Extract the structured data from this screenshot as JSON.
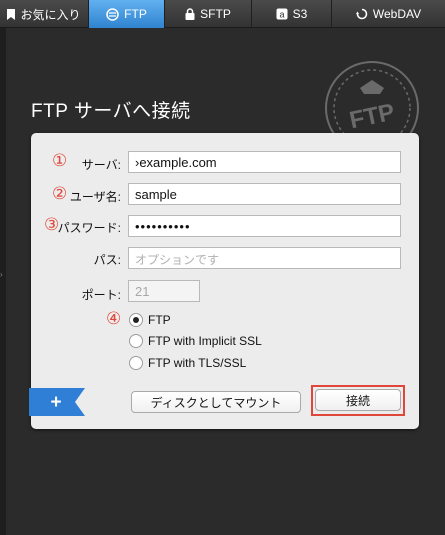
{
  "tabs": [
    {
      "label": "お気に入り",
      "icon": "bookmark-icon",
      "active": false
    },
    {
      "label": "FTP",
      "icon": "ftp-globe-icon",
      "active": true
    },
    {
      "label": "SFTP",
      "icon": "lock-icon",
      "active": false
    },
    {
      "label": "S3",
      "icon": "s3-logo-icon",
      "active": false
    },
    {
      "label": "WebDAV",
      "icon": "webdav-icon",
      "active": false
    }
  ],
  "title": "FTP サーバへ接続",
  "stamp_text": "FTP",
  "form": {
    "server": {
      "num": "①",
      "label": "サーバ:",
      "value": "›example.com"
    },
    "user": {
      "num": "②",
      "label": "ユーザ名:",
      "value": "sample"
    },
    "password": {
      "num": "③",
      "label": "パスワード:",
      "value": "••••••••••"
    },
    "path": {
      "label": "パス:",
      "placeholder": "オプションです"
    },
    "port": {
      "label": "ポート:",
      "placeholder": "21"
    },
    "protocol_num": "④",
    "protocols": [
      {
        "label": "FTP",
        "selected": true
      },
      {
        "label": "FTP with Implicit SSL",
        "selected": false
      },
      {
        "label": "FTP with TLS/SSL",
        "selected": false
      }
    ]
  },
  "buttons": {
    "mount_label": "ディスクとしてマウント",
    "connect_label": "接続",
    "add_label": "+"
  },
  "colors": {
    "accent_blue": "#2f84d0",
    "annotation_red": "#e0473a",
    "ribbon_blue": "#2f7fd6"
  }
}
